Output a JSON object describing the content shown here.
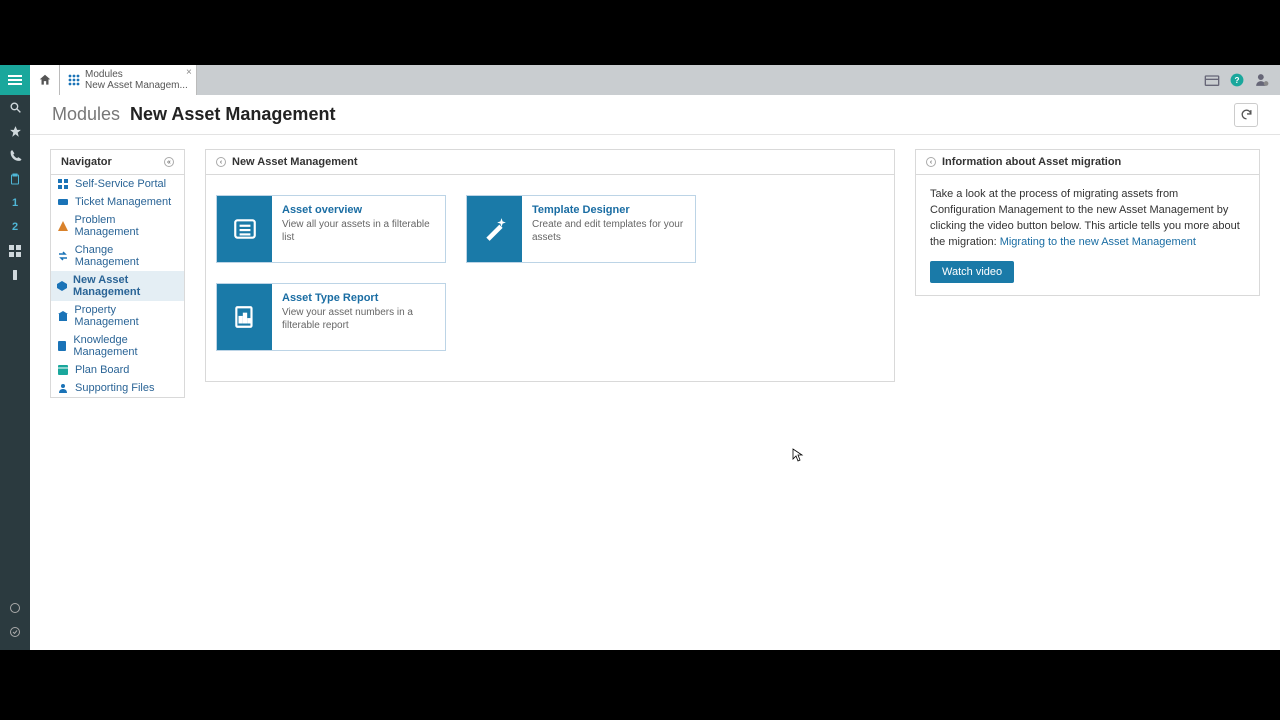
{
  "rail": {
    "items": [
      "search",
      "star",
      "call",
      "clipboard",
      "one",
      "two",
      "apps",
      "info"
    ]
  },
  "tab": {
    "line1": "Modules",
    "line2": "New Asset Managem..."
  },
  "breadcrumb": {
    "parent": "Modules",
    "current": "New Asset Management"
  },
  "navigator": {
    "title": "Navigator",
    "items": [
      {
        "label": "Self-Service Portal",
        "icon": "grid",
        "color": "blue",
        "active": false
      },
      {
        "label": "Ticket Management",
        "icon": "ticket",
        "color": "blue",
        "active": false
      },
      {
        "label": "Problem Management",
        "icon": "warn",
        "color": "orange",
        "active": false
      },
      {
        "label": "Change Management",
        "icon": "change",
        "color": "blue",
        "active": false
      },
      {
        "label": "New Asset Management",
        "icon": "asset",
        "color": "blue",
        "active": true
      },
      {
        "label": "Property Management",
        "icon": "prop",
        "color": "blue",
        "active": false
      },
      {
        "label": "Knowledge Management",
        "icon": "knowledge",
        "color": "blue",
        "active": false
      },
      {
        "label": "Plan Board",
        "icon": "plan",
        "color": "teal",
        "active": false
      },
      {
        "label": "Supporting Files",
        "icon": "files",
        "color": "blue",
        "active": false
      }
    ]
  },
  "midPanel": {
    "title": "New Asset Management",
    "cards": [
      {
        "title": "Asset overview",
        "desc": "View all your assets in a filterable list",
        "icon": "list"
      },
      {
        "title": "Template Designer",
        "desc": "Create and edit templates for your assets",
        "icon": "wand"
      },
      {
        "title": "Asset Type Report",
        "desc": "View your asset numbers in a filterable report",
        "icon": "report"
      }
    ]
  },
  "infoPanel": {
    "title": "Information about Asset migration",
    "text1": "Take a look at the process of migrating assets from Configuration Management to the new Asset Management by clicking the video button below. This article tells you more about the migration: ",
    "link": "Migrating to the new Asset Management",
    "button": "Watch video"
  }
}
